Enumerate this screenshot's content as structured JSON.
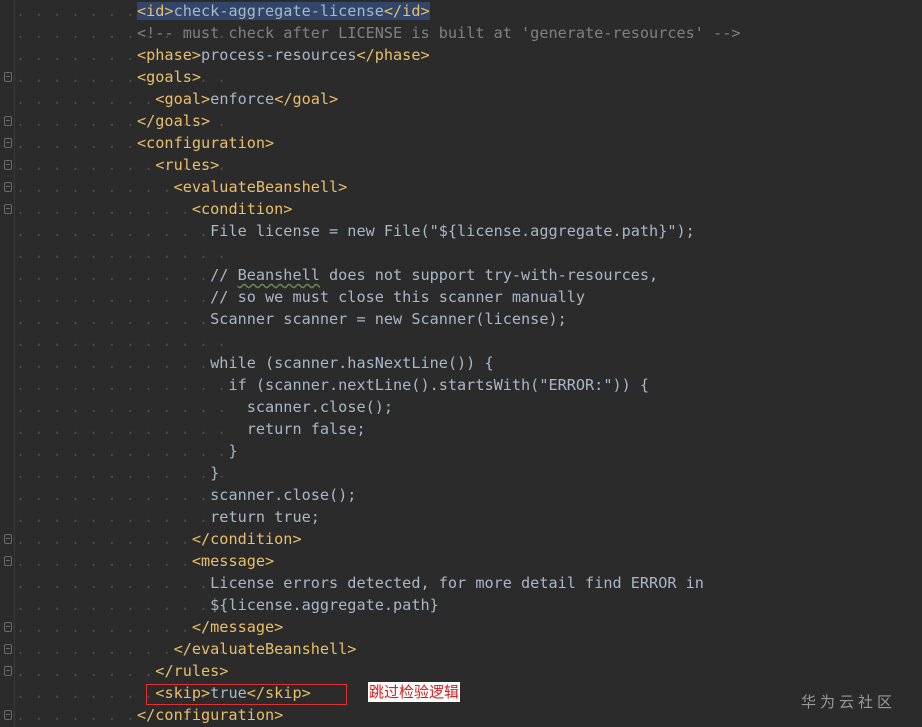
{
  "colors": {
    "background": "#2b2b2b",
    "tag": "#e8bf6a",
    "text": "#a9b7c6",
    "comment": "#808080",
    "annotation": "#e01818"
  },
  "lines": [
    {
      "parts": [
        {
          "t": "<id>",
          "c": "tag",
          "hl": true
        },
        {
          "t": "check-aggregate-license",
          "c": "txt",
          "hl": true
        },
        {
          "t": "</id>",
          "c": "tag",
          "hl": true
        }
      ]
    },
    {
      "parts": [
        {
          "t": "<!-- must check after LICENSE is built at 'generate-resources' -->",
          "c": "cmt"
        }
      ]
    },
    {
      "parts": [
        {
          "t": "<phase>",
          "c": "tag"
        },
        {
          "t": "process-resources",
          "c": "txt"
        },
        {
          "t": "</phase>",
          "c": "tag"
        }
      ]
    },
    {
      "parts": [
        {
          "t": "<goals>",
          "c": "tag"
        }
      ]
    },
    {
      "parts": [
        {
          "t": "  "
        },
        {
          "t": "<goal>",
          "c": "tag"
        },
        {
          "t": "enforce",
          "c": "txt"
        },
        {
          "t": "</goal>",
          "c": "tag"
        }
      ]
    },
    {
      "parts": [
        {
          "t": "</goals>",
          "c": "tag"
        }
      ]
    },
    {
      "parts": [
        {
          "t": "<configuration>",
          "c": "tag"
        }
      ]
    },
    {
      "parts": [
        {
          "t": "  "
        },
        {
          "t": "<rules>",
          "c": "tag"
        }
      ]
    },
    {
      "parts": [
        {
          "t": "    "
        },
        {
          "t": "<evaluateBeanshell>",
          "c": "tag"
        }
      ]
    },
    {
      "parts": [
        {
          "t": "      "
        },
        {
          "t": "<condition>",
          "c": "tag"
        }
      ]
    },
    {
      "parts": [
        {
          "t": "        "
        },
        {
          "t": "File license = new File(\"${license.aggregate.path}\");",
          "c": "txt"
        }
      ]
    },
    {
      "parts": [
        {
          "t": ""
        }
      ]
    },
    {
      "parts": [
        {
          "t": "        "
        },
        {
          "t": "// ",
          "c": "txt"
        },
        {
          "t": "Beanshell",
          "c": "txt",
          "sq": true
        },
        {
          "t": " does not support try-with-resources,",
          "c": "txt"
        }
      ]
    },
    {
      "parts": [
        {
          "t": "        "
        },
        {
          "t": "// so we must close this scanner manually",
          "c": "txt"
        }
      ]
    },
    {
      "parts": [
        {
          "t": "        "
        },
        {
          "t": "Scanner scanner = new Scanner(license);",
          "c": "txt"
        }
      ]
    },
    {
      "parts": [
        {
          "t": ""
        }
      ]
    },
    {
      "parts": [
        {
          "t": "        "
        },
        {
          "t": "while (scanner.hasNextLine()) {",
          "c": "txt"
        }
      ]
    },
    {
      "parts": [
        {
          "t": "          "
        },
        {
          "t": "if (scanner.nextLine().startsWith(\"ERROR:\")) {",
          "c": "txt"
        }
      ]
    },
    {
      "parts": [
        {
          "t": "            "
        },
        {
          "t": "scanner.close();",
          "c": "txt"
        }
      ]
    },
    {
      "parts": [
        {
          "t": "            "
        },
        {
          "t": "return false;",
          "c": "txt"
        }
      ]
    },
    {
      "parts": [
        {
          "t": "          "
        },
        {
          "t": "}",
          "c": "txt"
        }
      ]
    },
    {
      "parts": [
        {
          "t": "        "
        },
        {
          "t": "}",
          "c": "txt"
        }
      ]
    },
    {
      "parts": [
        {
          "t": "        "
        },
        {
          "t": "scanner.close();",
          "c": "txt"
        }
      ]
    },
    {
      "parts": [
        {
          "t": "        "
        },
        {
          "t": "return true;",
          "c": "txt"
        }
      ]
    },
    {
      "parts": [
        {
          "t": "      "
        },
        {
          "t": "</condition>",
          "c": "tag"
        }
      ]
    },
    {
      "parts": [
        {
          "t": "      "
        },
        {
          "t": "<message>",
          "c": "tag"
        }
      ]
    },
    {
      "parts": [
        {
          "t": "        "
        },
        {
          "t": "License errors detected, for more detail find ERROR in",
          "c": "txt"
        }
      ]
    },
    {
      "parts": [
        {
          "t": "        "
        },
        {
          "t": "${license.aggregate.path}",
          "c": "txt"
        }
      ]
    },
    {
      "parts": [
        {
          "t": "      "
        },
        {
          "t": "</message>",
          "c": "tag"
        }
      ]
    },
    {
      "parts": [
        {
          "t": "    "
        },
        {
          "t": "</evaluateBeanshell>",
          "c": "tag"
        }
      ]
    },
    {
      "parts": [
        {
          "t": "  "
        },
        {
          "t": "</rules>",
          "c": "tag"
        }
      ]
    },
    {
      "parts": [
        {
          "t": "  "
        },
        {
          "t": "<skip>",
          "c": "tag"
        },
        {
          "t": "true",
          "c": "txt"
        },
        {
          "t": "</skip>",
          "c": "tag"
        }
      ]
    },
    {
      "parts": [
        {
          "t": "</configuration>",
          "c": "tag"
        }
      ]
    }
  ],
  "folds": [
    3,
    5,
    6,
    7,
    8,
    9,
    24,
    25,
    28,
    29,
    30,
    32
  ],
  "annotation": {
    "text": "跳过检验逻辑"
  },
  "watermark": {
    "text": "华为云社区"
  }
}
